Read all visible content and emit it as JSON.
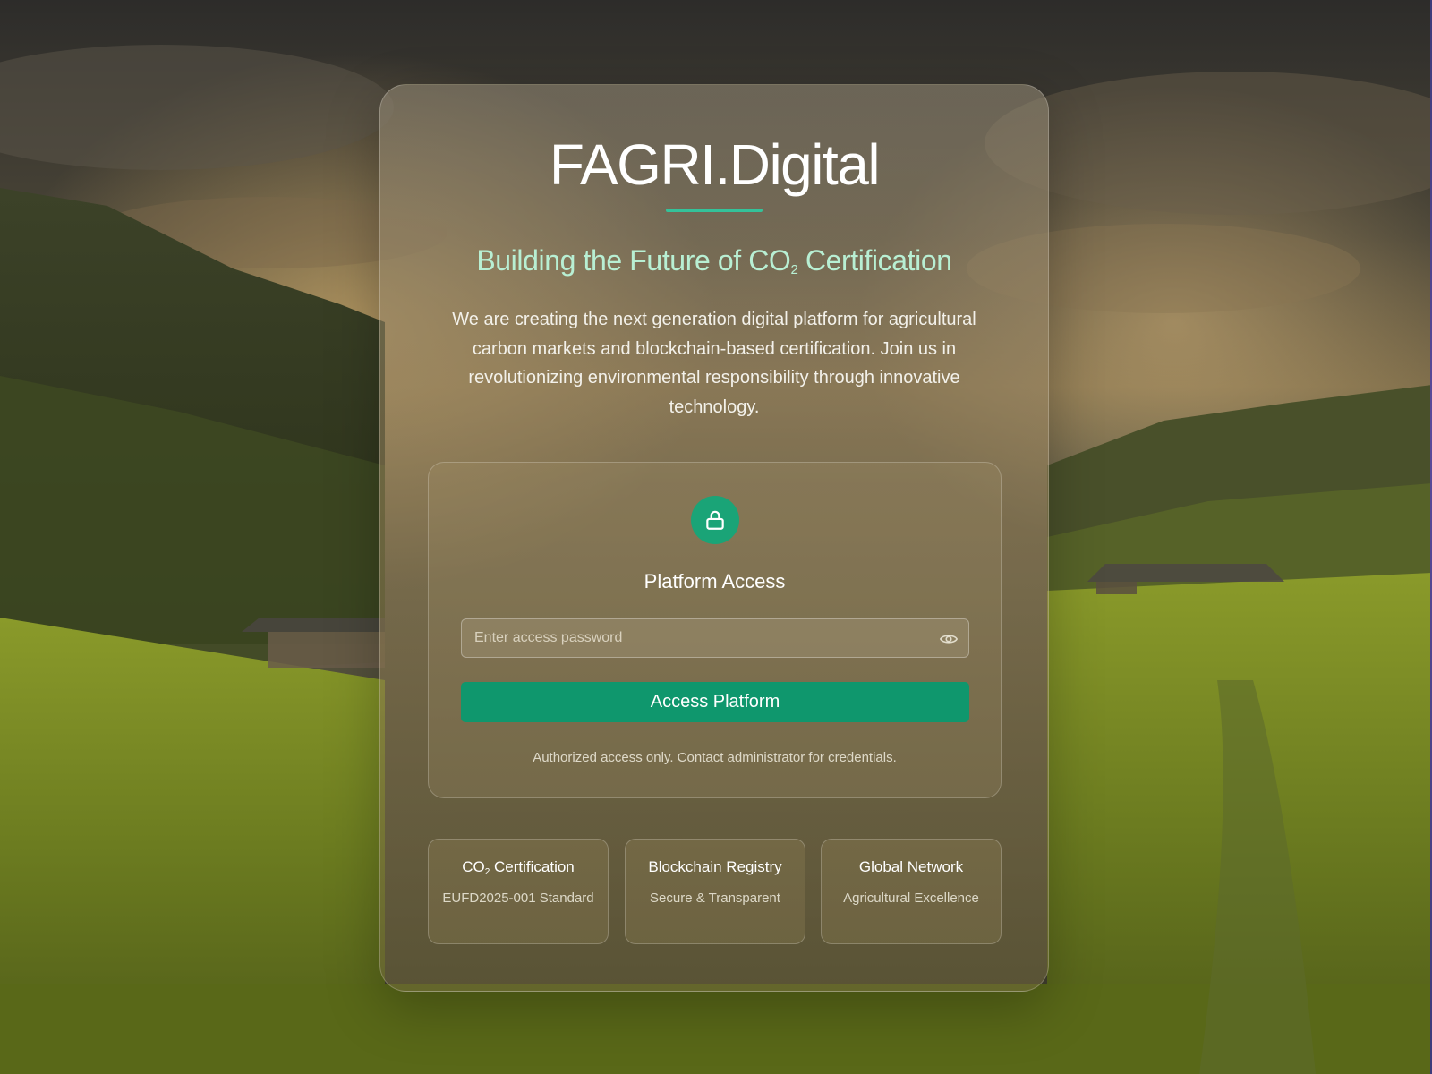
{
  "brand": {
    "name": "FAGRI.Digital"
  },
  "hero": {
    "headline_before": "Building the Future of CO",
    "headline_sub": "2",
    "headline_after": " Certification",
    "intro": "We are creating the next generation digital platform for agricultural carbon markets and blockchain-based certification. Join us in revolutionizing environmental responsibility through innovative technology."
  },
  "access": {
    "icon": "lock-icon",
    "title": "Platform Access",
    "password_placeholder": "Enter access password",
    "password_value": "",
    "toggle_icon": "eye-icon",
    "submit_label": "Access Platform",
    "note": "Authorized access only. Contact administrator for credentials."
  },
  "features": [
    {
      "title_before": "CO",
      "title_sub": "2",
      "title_after": " Certification",
      "desc": "EUFD2025-001 Standard"
    },
    {
      "title": "Blockchain Registry",
      "desc": "Secure & Transparent"
    },
    {
      "title": "Global Network",
      "desc": "Agricultural Excellence"
    }
  ],
  "colors": {
    "accent": "#34c29a",
    "headline": "#b8efd3",
    "button": "#0f976d",
    "lock_badge": "#1aa477"
  }
}
